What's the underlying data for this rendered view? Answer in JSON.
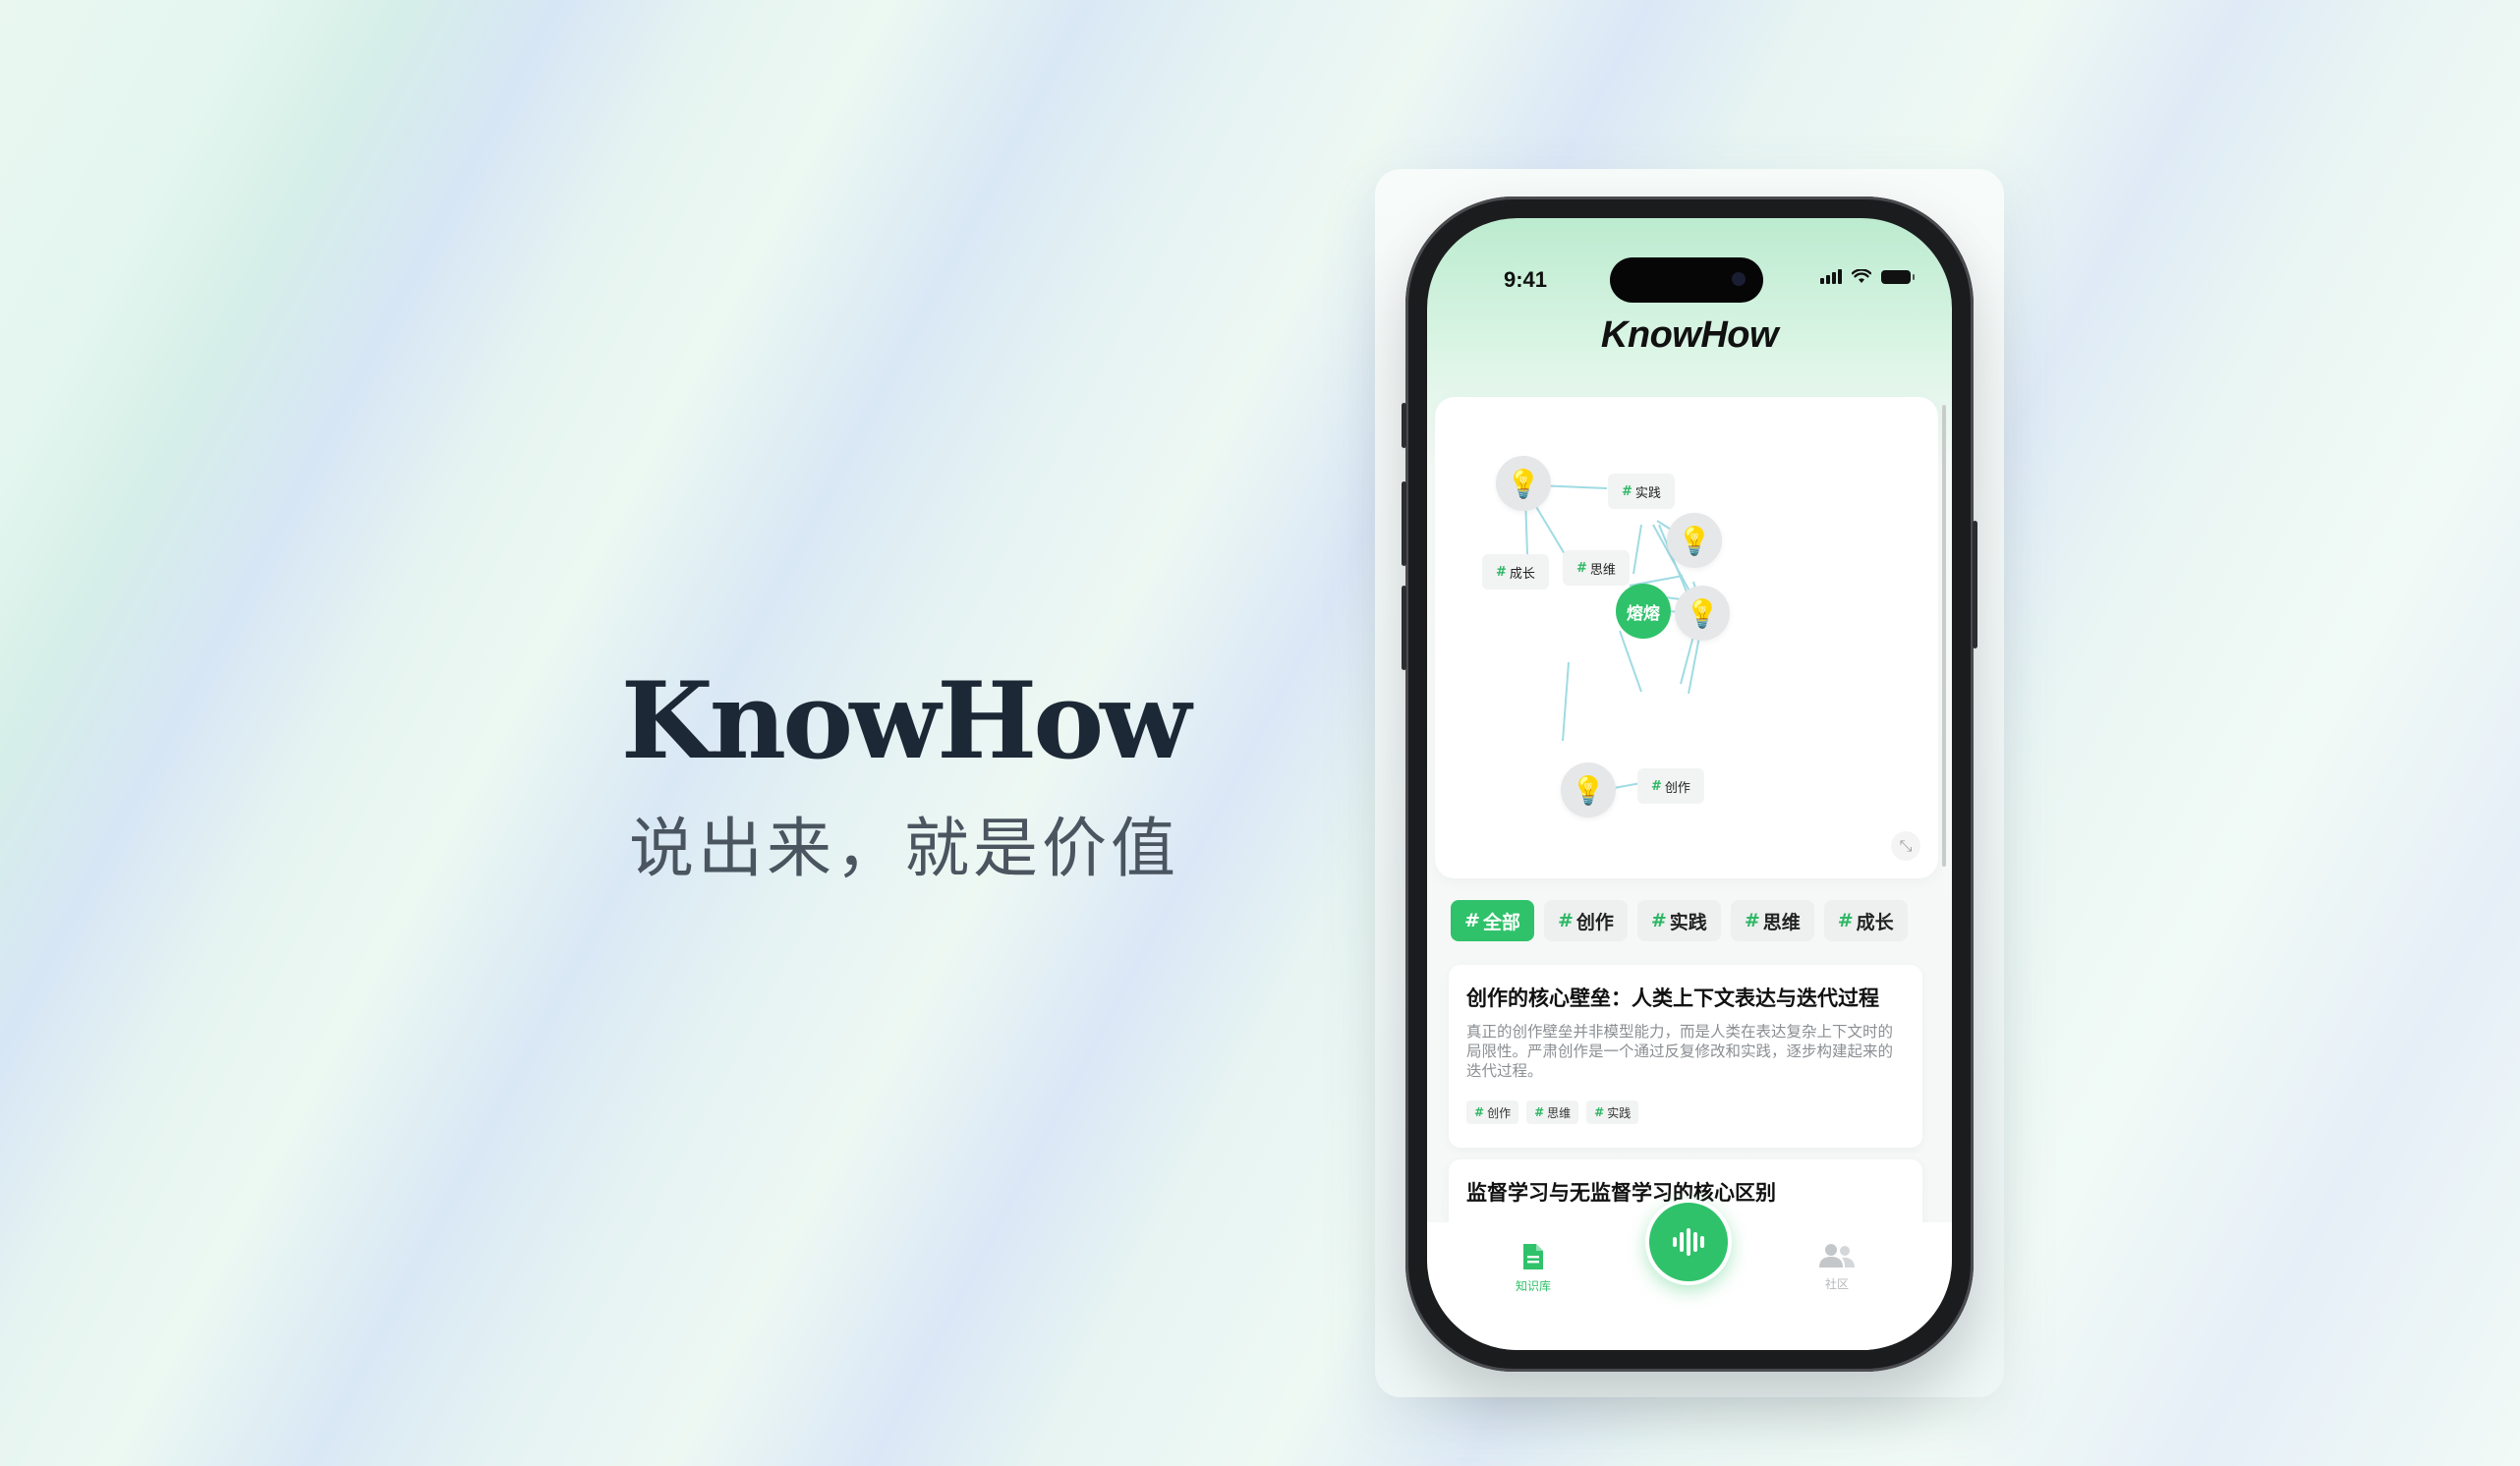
{
  "hero": {
    "title": "KnowHow",
    "slogan": "说出来，就是价值"
  },
  "status_bar": {
    "time": "9:41"
  },
  "app": {
    "title": "KnowHow"
  },
  "graph": {
    "center_node": "熔熔",
    "tags": {
      "shijian": "实践",
      "chengzhang": "成长",
      "siwei": "思维",
      "chuangzuo": "创作"
    },
    "hash": "#",
    "bulb_icon": "lightbulb-icon",
    "expand_icon": "expand-icon"
  },
  "filters": [
    {
      "hash": "#",
      "label": "全部",
      "active": true
    },
    {
      "hash": "#",
      "label": "创作",
      "active": false
    },
    {
      "hash": "#",
      "label": "实践",
      "active": false
    },
    {
      "hash": "#",
      "label": "思维",
      "active": false
    },
    {
      "hash": "#",
      "label": "成长",
      "active": false
    }
  ],
  "articles": [
    {
      "title": "创作的核心壁垒：人类上下文表达与迭代过程",
      "summary": "真正的创作壁垒并非模型能力，而是人类在表达复杂上下文时的局限性。严肃创作是一个通过反复修改和实践，逐步构建起来的迭代过程。",
      "tags": [
        "创作",
        "思维",
        "实践"
      ]
    },
    {
      "title": "监督学习与无监督学习的核心区别"
    }
  ],
  "tabbar": {
    "knowledge_label": "知识库",
    "community_label": "社区",
    "accent": "#2fc26a"
  }
}
